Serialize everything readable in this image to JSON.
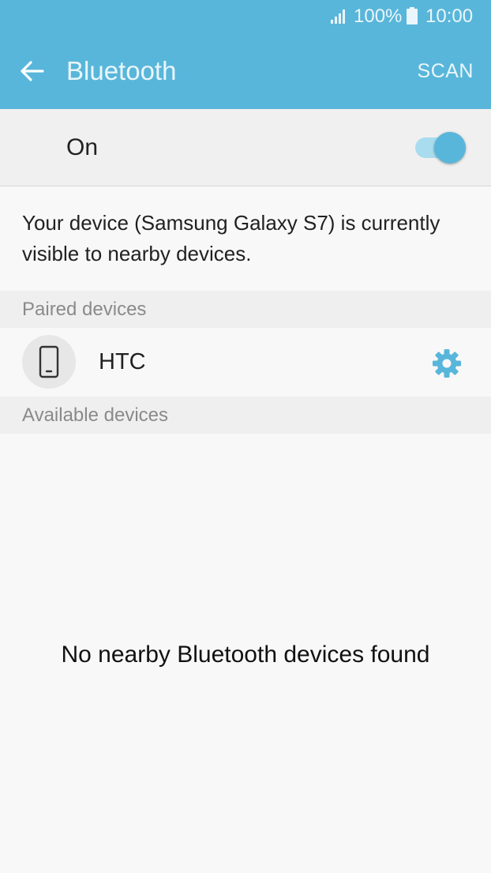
{
  "status_bar": {
    "battery_percent": "100%",
    "time": "10:00",
    "icons": [
      "signal-icon",
      "battery-icon"
    ]
  },
  "action_bar": {
    "back_icon": "arrow-left-icon",
    "title": "Bluetooth",
    "scan_label": "SCAN"
  },
  "master_switch": {
    "label": "On",
    "state": true
  },
  "visibility_message": "Your device (Samsung Galaxy S7) is currently visible to nearby devices.",
  "sections": {
    "paired_header": "Paired devices",
    "available_header": "Available devices"
  },
  "paired_devices": [
    {
      "name": "HTC",
      "icon": "smartphone-icon",
      "settings_icon": "gear-icon"
    }
  ],
  "available_empty_message": "No nearby Bluetooth devices found",
  "colors": {
    "accent": "#58b6da",
    "toggle_track": "#a9dcef",
    "section_background": "#efefef",
    "section_text": "#8a8a8a"
  }
}
